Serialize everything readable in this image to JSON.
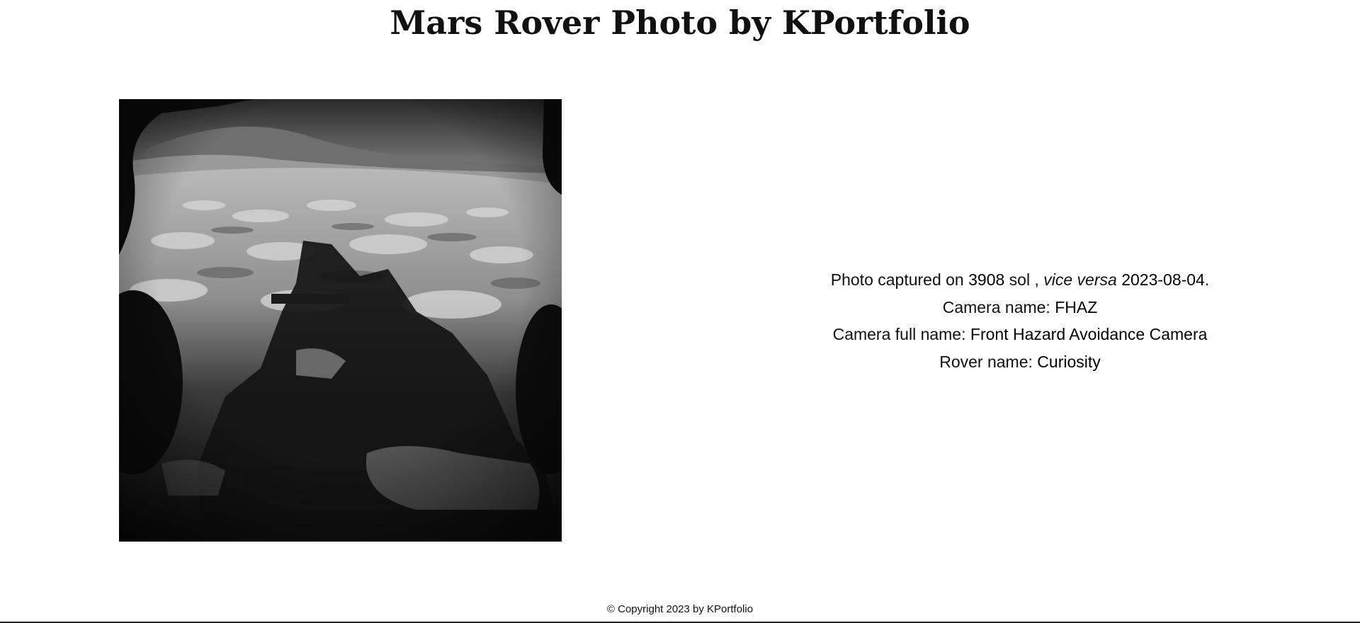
{
  "page": {
    "title": "Mars Rover Photo by KPortfolio"
  },
  "photo": {
    "alt": "Mars Rover Photo"
  },
  "info": {
    "captured_prefix": "Photo captured on ",
    "sol": "3908",
    "sol_label": " sol , ",
    "vice_versa": "vice versa",
    "earth_date": "2023-08-04",
    "period": ".",
    "camera_name_label": "Camera name: ",
    "camera_name": "FHAZ",
    "camera_full_name_label": "Camera full name: ",
    "camera_full_name": "Front Hazard Avoidance Camera",
    "rover_name_label": "Rover name: ",
    "rover_name": "Curiosity"
  },
  "footer": {
    "copyright": "© Copyright 2023 by KPortfolio"
  },
  "colors": {
    "background": "#ffffff",
    "text": "#111111",
    "rule": "#222222"
  }
}
